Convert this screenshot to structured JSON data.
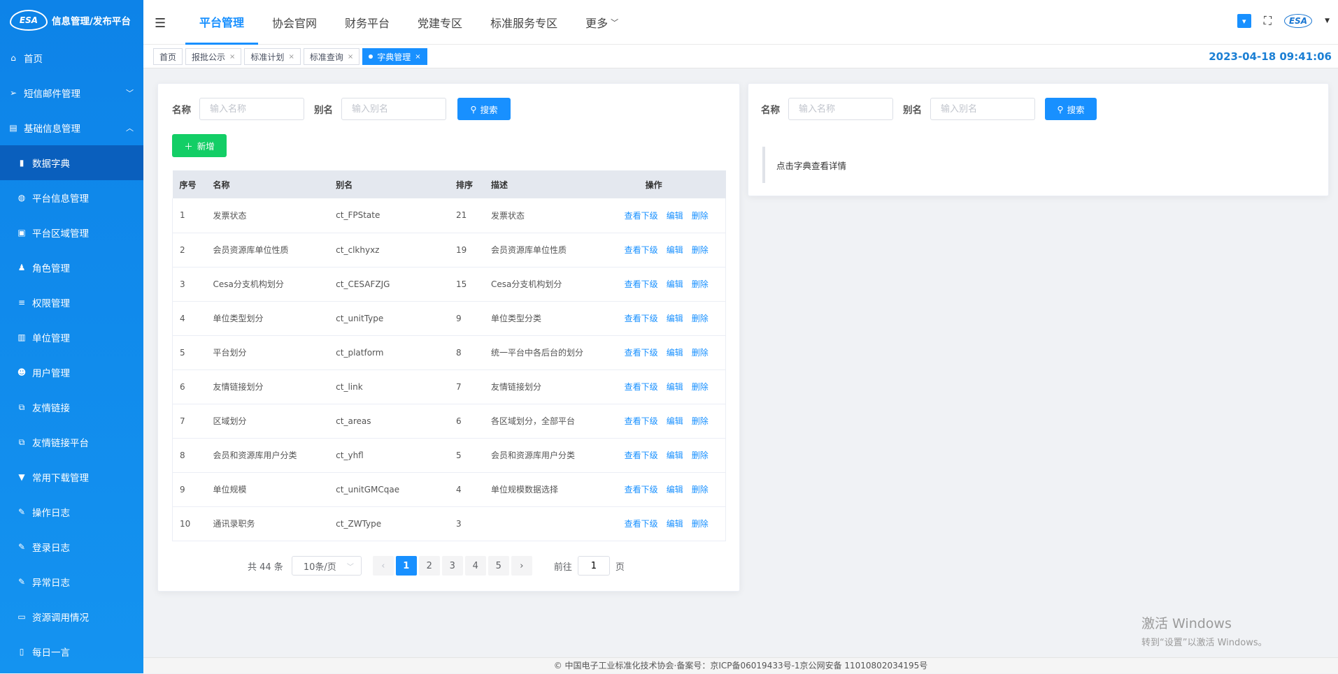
{
  "app": {
    "title": "信息管理/发布平台",
    "logo_text": "ESA"
  },
  "sidebar": {
    "items": [
      {
        "label": "首页",
        "icon": "home-icon"
      },
      {
        "label": "短信邮件管理",
        "icon": "send-icon",
        "expanded": false
      },
      {
        "label": "基础信息管理",
        "icon": "database-icon",
        "expanded": true
      }
    ],
    "sub_items": [
      {
        "label": "数据字典",
        "icon": "book-icon",
        "active": true
      },
      {
        "label": "平台信息管理",
        "icon": "globe-icon"
      },
      {
        "label": "平台区域管理",
        "icon": "map-icon"
      },
      {
        "label": "角色管理",
        "icon": "user-role-icon"
      },
      {
        "label": "权限管理",
        "icon": "list-icon"
      },
      {
        "label": "单位管理",
        "icon": "building-icon"
      },
      {
        "label": "用户管理",
        "icon": "user-icon"
      },
      {
        "label": "友情链接",
        "icon": "external-link-icon"
      },
      {
        "label": "友情链接平台",
        "icon": "external-link-icon"
      },
      {
        "label": "常用下载管理",
        "icon": "download-icon"
      },
      {
        "label": "操作日志",
        "icon": "edit-icon"
      },
      {
        "label": "登录日志",
        "icon": "edit-icon"
      },
      {
        "label": "异常日志",
        "icon": "edit-icon"
      },
      {
        "label": "资源调用情况",
        "icon": "monitor-icon"
      },
      {
        "label": "每日一言",
        "icon": "quote-icon"
      }
    ]
  },
  "header": {
    "nav": [
      "平台管理",
      "协会官网",
      "财务平台",
      "党建专区",
      "标准服务专区",
      "更多"
    ],
    "active_nav": "平台管理",
    "datetime": "2023-04-18 09:41:06"
  },
  "tabs": [
    {
      "label": "首页",
      "closable": false
    },
    {
      "label": "报批公示",
      "closable": true
    },
    {
      "label": "标准计划",
      "closable": true
    },
    {
      "label": "标准查询",
      "closable": true
    },
    {
      "label": "字典管理",
      "closable": true,
      "active": true
    }
  ],
  "left_panel": {
    "name_label": "名称",
    "name_placeholder": "输入名称",
    "alias_label": "别名",
    "alias_placeholder": "输入别名",
    "search_label": "搜索",
    "add_label": "新增",
    "columns": [
      "序号",
      "名称",
      "别名",
      "排序",
      "描述",
      "操作"
    ],
    "row_actions": [
      "查看下级",
      "编辑",
      "删除"
    ],
    "rows": [
      [
        "1",
        "发票状态",
        "ct_FPState",
        "21",
        "发票状态"
      ],
      [
        "2",
        "会员资源库单位性质",
        "ct_clkhyxz",
        "19",
        "会员资源库单位性质"
      ],
      [
        "3",
        "Cesa分支机构划分",
        "ct_CESAFZJG",
        "15",
        "Cesa分支机构划分"
      ],
      [
        "4",
        "单位类型划分",
        "ct_unitType",
        "9",
        "单位类型分类"
      ],
      [
        "5",
        "平台划分",
        "ct_platform",
        "8",
        "统一平台中各后台的划分"
      ],
      [
        "6",
        "友情链接划分",
        "ct_link",
        "7",
        "友情链接划分"
      ],
      [
        "7",
        "区域划分",
        "ct_areas",
        "6",
        "各区域划分，全部平台"
      ],
      [
        "8",
        "会员和资源库用户分类",
        "ct_yhfl",
        "5",
        "会员和资源库用户分类"
      ],
      [
        "9",
        "单位规模",
        "ct_unitGMCqae",
        "4",
        "单位规模数据选择"
      ],
      [
        "10",
        "通讯录职务",
        "ct_ZWType",
        "3",
        ""
      ]
    ],
    "pagination": {
      "total_text": "共 44 条",
      "page_size": "10条/页",
      "pages": [
        "1",
        "2",
        "3",
        "4",
        "5"
      ],
      "current": "1",
      "goto_prefix": "前往",
      "goto_value": "1",
      "goto_suffix": "页"
    }
  },
  "right_panel": {
    "name_label": "名称",
    "name_placeholder": "输入名称",
    "alias_label": "别名",
    "alias_placeholder": "输入别名",
    "search_label": "搜索",
    "hint": "点击字典查看详情"
  },
  "watermark": {
    "line1": "激活 Windows",
    "line2": "转到“设置”以激活 Windows。"
  },
  "footer": {
    "text": "© 中国电子工业标准化技术协会·备案号：京ICP备06019433号-1京公网安备 11010802034195号"
  },
  "colors": {
    "primary": "#1890ff",
    "sidebar": "#0d83e8",
    "add_button": "#13ce66"
  }
}
